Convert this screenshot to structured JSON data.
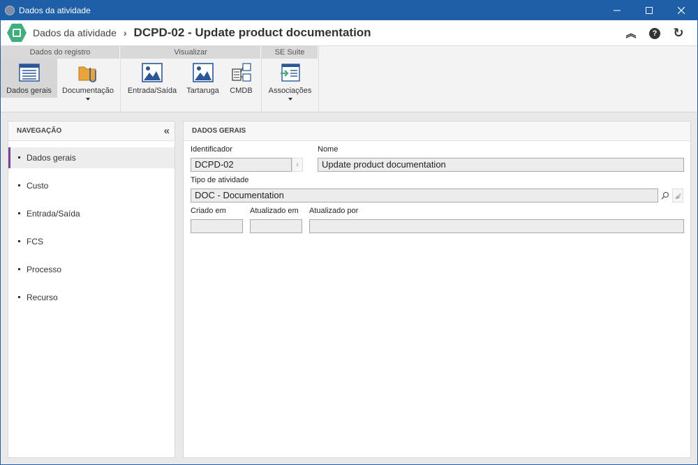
{
  "window": {
    "title": "Dados da atividade"
  },
  "header": {
    "breadcrumb_root": "Dados da atividade",
    "breadcrumb_current": "DCPD-02 - Update product documentation",
    "collapse_glyph": "︽",
    "help_glyph": "?",
    "refresh_glyph": "↻"
  },
  "ribbon": {
    "groups": [
      {
        "title": "Dados do registro",
        "items": [
          {
            "label": "Dados gerais",
            "icon": "form-icon"
          },
          {
            "label": "Documentação",
            "icon": "folder-clip-icon"
          }
        ]
      },
      {
        "title": "Visualizar",
        "items": [
          {
            "label": "Entrada/Saída",
            "icon": "image-icon"
          },
          {
            "label": "Tartaruga",
            "icon": "image-icon"
          },
          {
            "label": "CMDB",
            "icon": "cmdb-icon"
          }
        ]
      },
      {
        "title": "SE Suite",
        "items": [
          {
            "label": "Associações",
            "icon": "association-icon"
          }
        ]
      }
    ]
  },
  "nav": {
    "title": "NAVEGAÇÃO",
    "collapse_glyph": "«",
    "items": [
      "Dados gerais",
      "Custo",
      "Entrada/Saída",
      "FCS",
      "Processo",
      "Recurso"
    ]
  },
  "main": {
    "title": "DADOS GERAIS",
    "fields": {
      "identificador": {
        "label": "Identificador",
        "value": "DCPD-02"
      },
      "nome": {
        "label": "Nome",
        "value": "Update product documentation"
      },
      "tipo": {
        "label": "Tipo de atividade",
        "value": "DOC - Documentation"
      },
      "criado": {
        "label": "Criado em",
        "value": ""
      },
      "atualizado": {
        "label": "Atualizado em",
        "value": ""
      },
      "atualizado_por": {
        "label": "Atualizado por",
        "value": ""
      }
    }
  },
  "colors": {
    "titlebar": "#1f5fa8",
    "logo": "#3fae7c",
    "active_nav": "#7b3fa0"
  }
}
